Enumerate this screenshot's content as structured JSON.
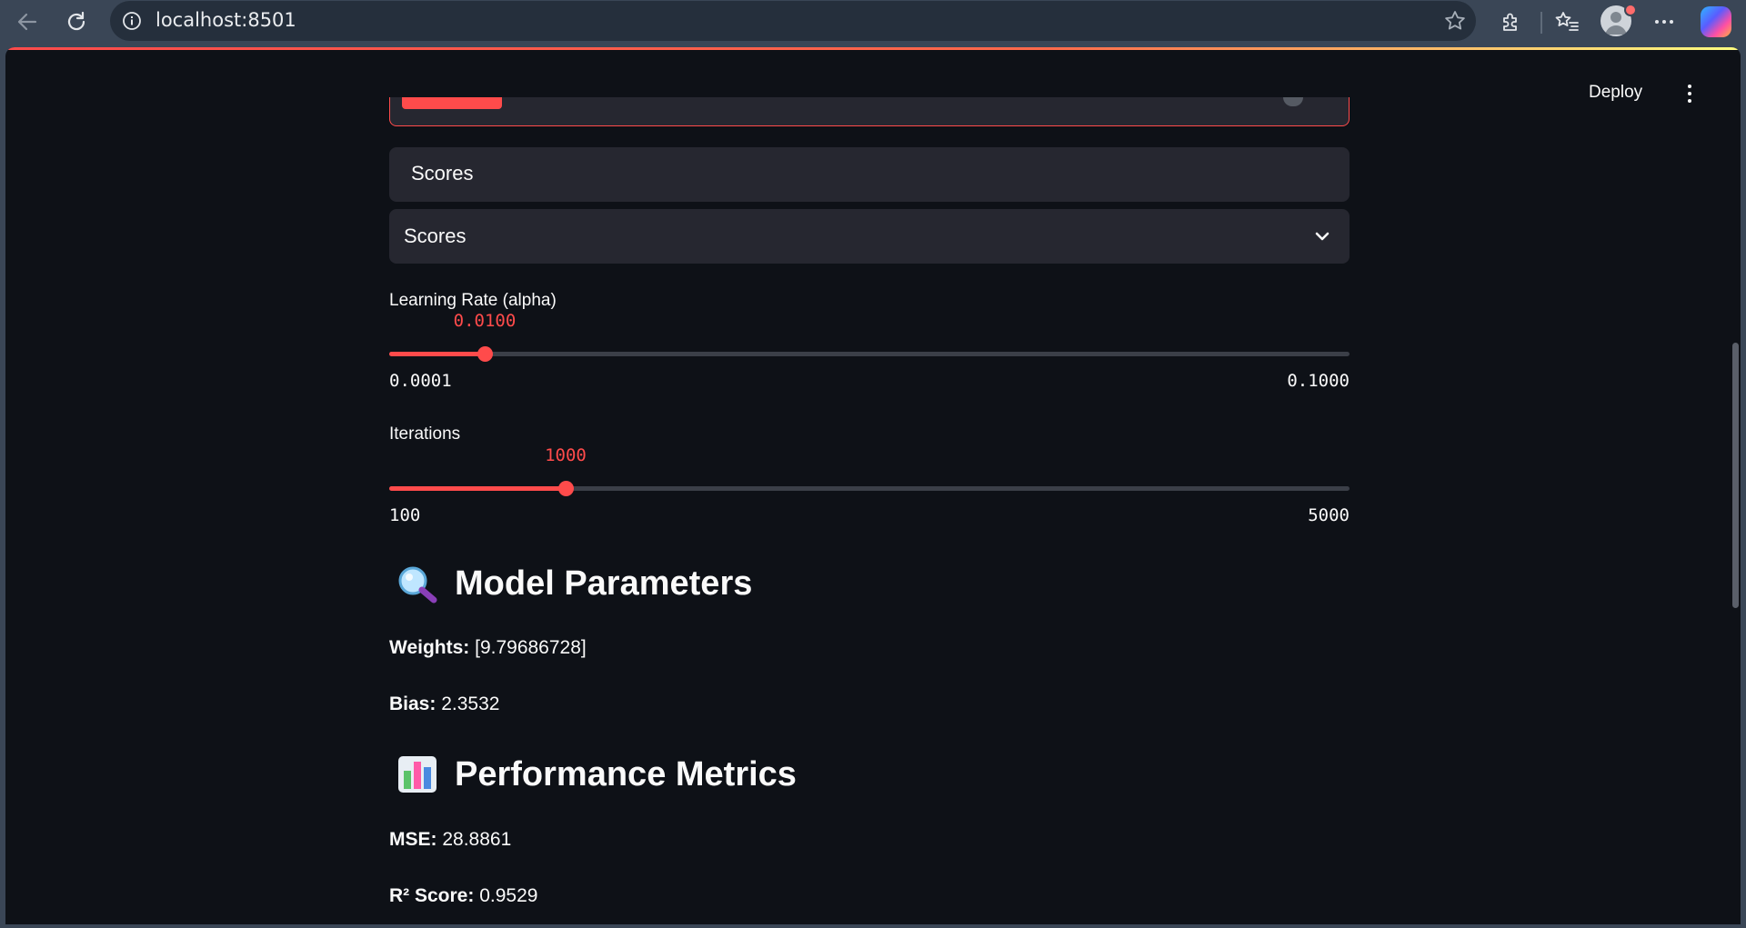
{
  "browser": {
    "url": "localhost:8501"
  },
  "app": {
    "deploy_label": "Deploy",
    "dropdown_option": "Scores",
    "selectbox_value": "Scores",
    "sliders": [
      {
        "label": "Learning Rate (alpha)",
        "value_text": "0.0100",
        "min_text": "0.0001",
        "max_text": "0.1000",
        "fill_fraction": 0.099
      },
      {
        "label": "Iterations",
        "value_text": "1000",
        "min_text": "100",
        "max_text": "5000",
        "fill_fraction": 0.184
      }
    ],
    "model_parameters": {
      "heading": "Model Parameters",
      "weights_label": "Weights:",
      "weights_value": " [9.79686728]",
      "bias_label": "Bias:",
      "bias_value": " 2.3532"
    },
    "performance_metrics": {
      "heading": "Performance Metrics",
      "mse_label": "MSE:",
      "mse_value": " 28.8861",
      "r2_label": "R² Score:",
      "r2_value": " 0.9529"
    },
    "colors": {
      "accent": "#ff4b4b",
      "background": "#0e1117",
      "widget": "#262730",
      "chrome": "#3a4656"
    }
  }
}
